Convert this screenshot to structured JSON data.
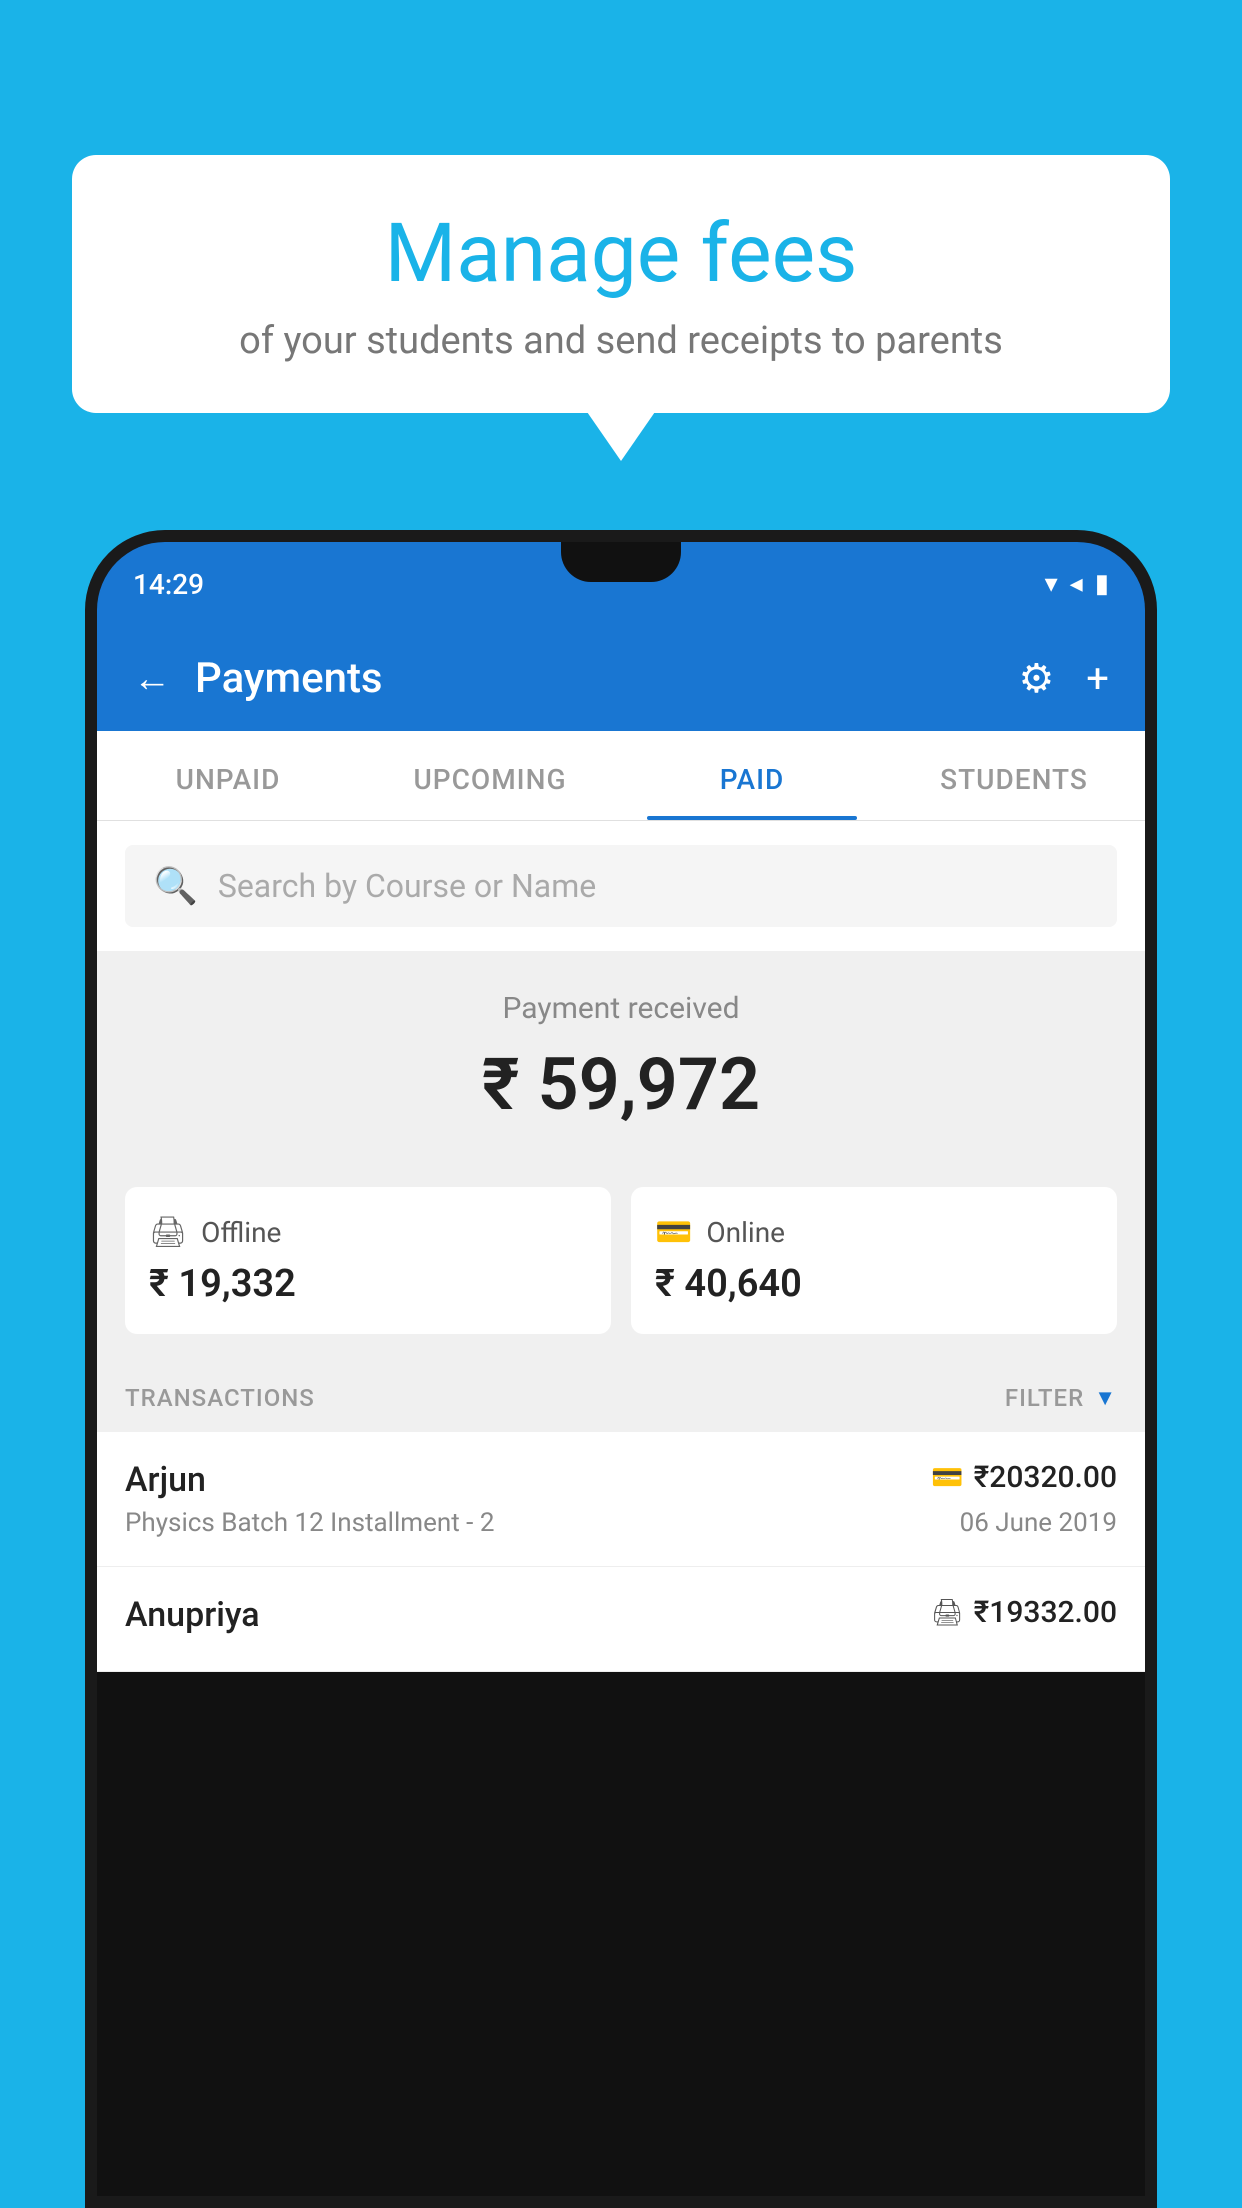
{
  "background_color": "#1ab3e8",
  "speech_bubble": {
    "title": "Manage fees",
    "subtitle": "of your students and send receipts to parents"
  },
  "status_bar": {
    "time": "14:29",
    "wifi_icon": "▼",
    "signal_icon": "▲",
    "battery_icon": "▮"
  },
  "header": {
    "title": "Payments",
    "back_label": "←",
    "gear_label": "⚙",
    "plus_label": "+"
  },
  "tabs": [
    {
      "label": "UNPAID",
      "active": false
    },
    {
      "label": "UPCOMING",
      "active": false
    },
    {
      "label": "PAID",
      "active": true
    },
    {
      "label": "STUDENTS",
      "active": false
    }
  ],
  "search": {
    "placeholder": "Search by Course or Name"
  },
  "payment_received": {
    "label": "Payment received",
    "amount": "₹ 59,972"
  },
  "cards": [
    {
      "type": "Offline",
      "icon": "💳",
      "amount": "₹ 19,332"
    },
    {
      "type": "Online",
      "icon": "💳",
      "amount": "₹ 40,640"
    }
  ],
  "transactions": {
    "label": "TRANSACTIONS",
    "filter_label": "FILTER"
  },
  "transaction_rows": [
    {
      "name": "Arjun",
      "course": "Physics Batch 12 Installment - 2",
      "amount": "₹20320.00",
      "date": "06 June 2019",
      "payment_type": "online"
    },
    {
      "name": "Anupriya",
      "course": "",
      "amount": "₹19332.00",
      "date": "",
      "payment_type": "offline"
    }
  ]
}
